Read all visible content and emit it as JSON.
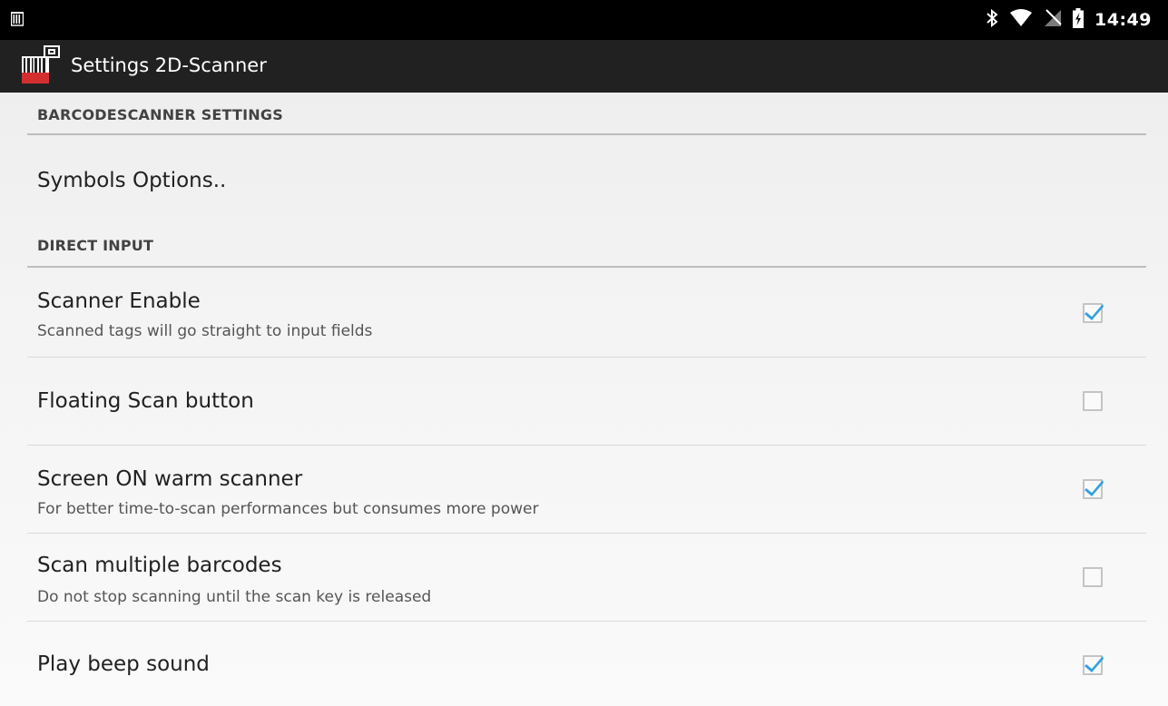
{
  "status_bar": {
    "time": "14:49",
    "icons": [
      "notification-icon",
      "bluetooth-icon",
      "wifi-icon",
      "no-signal-icon",
      "battery-charging-icon"
    ]
  },
  "action_bar": {
    "title": "Settings 2D-Scanner",
    "icon": "barcode-scanner-app-icon"
  },
  "sections": [
    {
      "header": "BARCODESCANNER SETTINGS"
    },
    {
      "header": "DIRECT INPUT"
    }
  ],
  "symbols_options": {
    "title": "Symbols Options.."
  },
  "preferences": [
    {
      "title": "Scanner Enable",
      "summary": "Scanned tags will go straight to input fields",
      "checked": true
    },
    {
      "title": "Floating Scan button",
      "summary": "",
      "checked": false
    },
    {
      "title": "Screen ON warm scanner",
      "summary": "For better time-to-scan performances but consumes more power",
      "checked": true
    },
    {
      "title": "Scan multiple barcodes",
      "summary": "Do not stop scanning until the scan key is released",
      "checked": false
    },
    {
      "title": "Play beep sound",
      "summary": "",
      "checked": true
    }
  ],
  "colors": {
    "accent": "#33a3dc",
    "status_bar": "#000000",
    "action_bar": "#212121",
    "app_icon_red": "#d32f2f"
  }
}
